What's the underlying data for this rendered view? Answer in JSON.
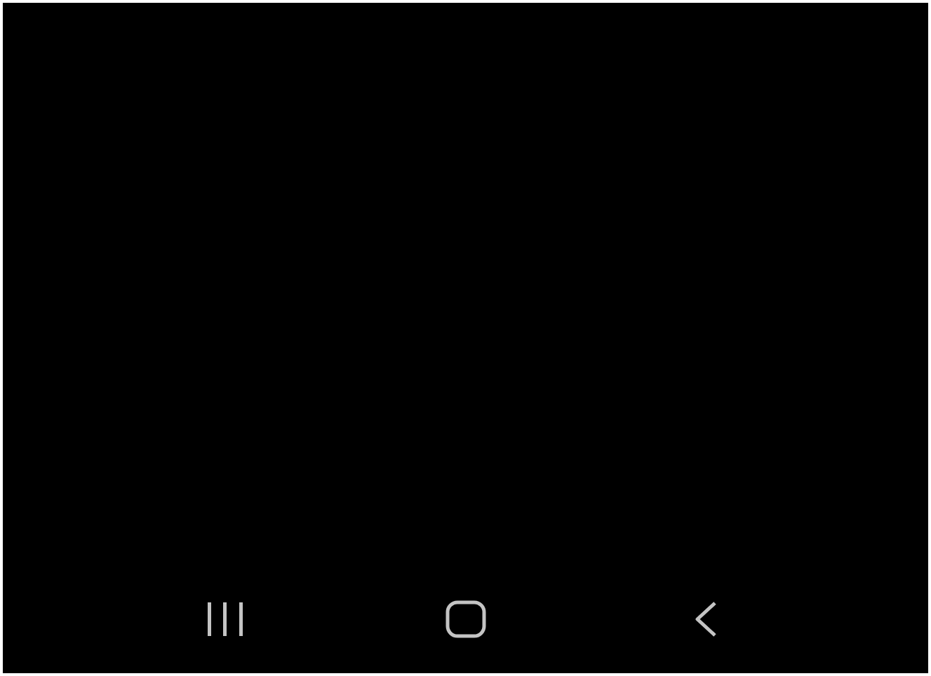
{
  "navigation_bar": {
    "buttons": [
      {
        "kind": "recents"
      },
      {
        "kind": "home"
      },
      {
        "kind": "back"
      }
    ]
  }
}
